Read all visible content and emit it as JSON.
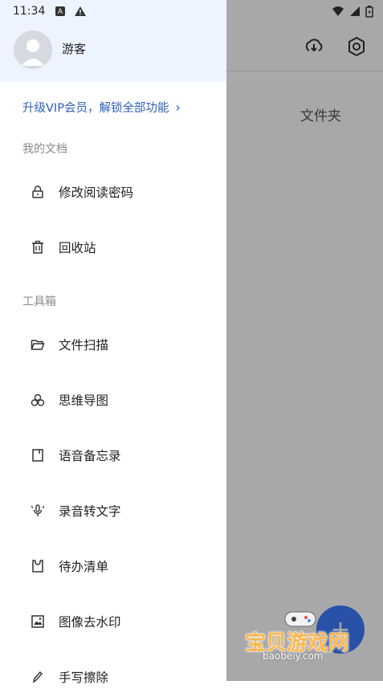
{
  "status_bar": {
    "time": "11:34"
  },
  "drawer": {
    "username": "游客",
    "vip_label": "升级VIP会员，解锁全部功能",
    "vip_chevron": "›",
    "sections": {
      "my_docs": "我的文档",
      "toolbox": "工具箱"
    },
    "items": [
      {
        "label": "修改阅读密码",
        "icon": "lock-icon"
      },
      {
        "label": "回收站",
        "icon": "trash-icon"
      },
      {
        "label": "文件扫描",
        "icon": "folder-open-icon"
      },
      {
        "label": "思维导图",
        "icon": "mindmap-icon"
      },
      {
        "label": "语音备忘录",
        "icon": "notebook-icon"
      },
      {
        "label": "录音转文字",
        "icon": "microphone-icon"
      },
      {
        "label": "待办清单",
        "icon": "todo-icon"
      },
      {
        "label": "图像去水印",
        "icon": "image-icon"
      },
      {
        "label": "手写擦除",
        "icon": "pen-icon"
      }
    ]
  },
  "background": {
    "folder_label": "文件夹",
    "fab_label": "+"
  },
  "watermark": {
    "title": "宝贝游戏网",
    "subtitle": "baobeiy.com"
  },
  "colors": {
    "drawer_header": "#edf4ff",
    "vip_text": "#2d5fb8",
    "scrim": "#000000"
  }
}
